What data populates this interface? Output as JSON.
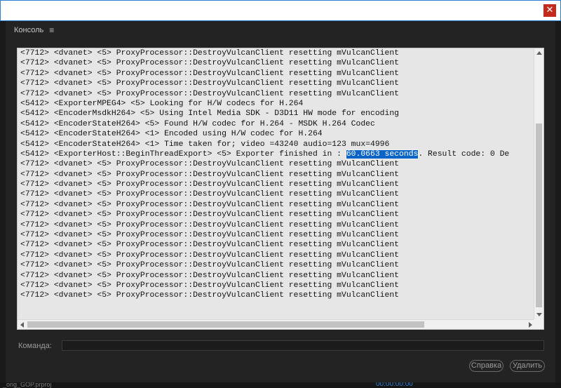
{
  "window": {
    "close_icon": "close-icon"
  },
  "panel": {
    "title": "Консоль",
    "menu_icon": "hamburger-menu-icon"
  },
  "console_lines": [
    "<7712> <dvanet> <5> ProxyProcessor::DestroyVulcanClient resetting mVulcanClient",
    "<7712> <dvanet> <5> ProxyProcessor::DestroyVulcanClient resetting mVulcanClient",
    "<7712> <dvanet> <5> ProxyProcessor::DestroyVulcanClient resetting mVulcanClient",
    "<7712> <dvanet> <5> ProxyProcessor::DestroyVulcanClient resetting mVulcanClient",
    "<7712> <dvanet> <5> ProxyProcessor::DestroyVulcanClient resetting mVulcanClient",
    "<5412> <ExporterMPEG4> <5> Looking for H/W codecs for H.264",
    "<5412> <EncoderMsdkH264> <5> Using Intel Media SDK - D3D11 HW mode for encoding",
    "<5412> <EncoderStateH264> <5> Found H/W codec for H.264 - MSDK H.264 Codec",
    "<5412> <EncoderStateH264> <1> Encoded using H/W codec for H.264",
    "<5412> <EncoderStateH264> <1> Time taken for; video =43240 audio=123 mux=4996"
  ],
  "export_line": {
    "before": "<5412> <ExporterHost::BeginThreadExport> <5> Exporter finished in : ",
    "highlight": "60.0663 seconds",
    "after": ". Result code: 0 De"
  },
  "console_lines_after": [
    "<7712> <dvanet> <5> ProxyProcessor::DestroyVulcanClient resetting mVulcanClient",
    "<7712> <dvanet> <5> ProxyProcessor::DestroyVulcanClient resetting mVulcanClient",
    "<7712> <dvanet> <5> ProxyProcessor::DestroyVulcanClient resetting mVulcanClient",
    "<7712> <dvanet> <5> ProxyProcessor::DestroyVulcanClient resetting mVulcanClient",
    "<7712> <dvanet> <5> ProxyProcessor::DestroyVulcanClient resetting mVulcanClient",
    "<7712> <dvanet> <5> ProxyProcessor::DestroyVulcanClient resetting mVulcanClient",
    "<7712> <dvanet> <5> ProxyProcessor::DestroyVulcanClient resetting mVulcanClient",
    "<7712> <dvanet> <5> ProxyProcessor::DestroyVulcanClient resetting mVulcanClient",
    "<7712> <dvanet> <5> ProxyProcessor::DestroyVulcanClient resetting mVulcanClient",
    "<7712> <dvanet> <5> ProxyProcessor::DestroyVulcanClient resetting mVulcanClient",
    "<7712> <dvanet> <5> ProxyProcessor::DestroyVulcanClient resetting mVulcanClient",
    "<7712> <dvanet> <5> ProxyProcessor::DestroyVulcanClient resetting mVulcanClient",
    "<7712> <dvanet> <5> ProxyProcessor::DestroyVulcanClient resetting mVulcanClient",
    "<7712> <dvanet> <5> ProxyProcessor::DestroyVulcanClient resetting mVulcanClient"
  ],
  "command": {
    "label": "Команда:",
    "value": ""
  },
  "buttons": {
    "help": "Справка",
    "delete": "Удалить"
  },
  "background": {
    "project_name": "_ong_GOP.prproj",
    "timecode": "00:00:00:00"
  },
  "colors": {
    "highlight": "#0a64c8",
    "close": "#c42b1c",
    "timecode": "#2d7fd6"
  }
}
